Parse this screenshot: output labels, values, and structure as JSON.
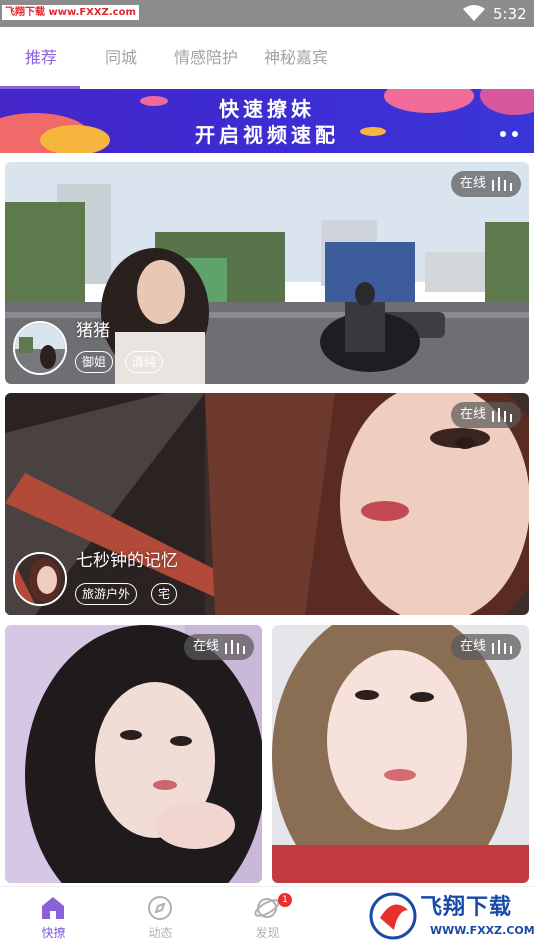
{
  "status_bar": {
    "watermark": "飞翔下载 www.FXXZ.com",
    "time": "5:32",
    "wifi_icon": "wifi-icon"
  },
  "tabs": [
    {
      "label": "推荐",
      "active": true
    },
    {
      "label": "同城",
      "active": false
    },
    {
      "label": "情感陪护",
      "active": false
    },
    {
      "label": "神秘嘉宾",
      "active": false
    }
  ],
  "banner": {
    "line1": "快速撩妹",
    "line2": "开启视频速配"
  },
  "cards": [
    {
      "online": "在线",
      "name": "猪猪",
      "tags": [
        "御姐",
        "清纯"
      ]
    },
    {
      "online": "在线",
      "name": "七秒钟的记忆",
      "tags": [
        "旅游户外",
        "宅"
      ]
    },
    {
      "online": "在线"
    },
    {
      "online": "在线"
    }
  ],
  "bottom_nav": {
    "items": [
      {
        "label": "快撩",
        "icon": "home-icon",
        "active": true
      },
      {
        "label": "动态",
        "icon": "compass-icon",
        "active": false
      },
      {
        "label": "发现",
        "icon": "planet-icon",
        "active": false,
        "badge": "1"
      }
    ]
  },
  "watermark_bottom": {
    "brand": "飞翔下载",
    "url": "WWW.FXXZ.COM"
  },
  "colors": {
    "accent": "#8a62d9",
    "badge": "#e8312f"
  }
}
